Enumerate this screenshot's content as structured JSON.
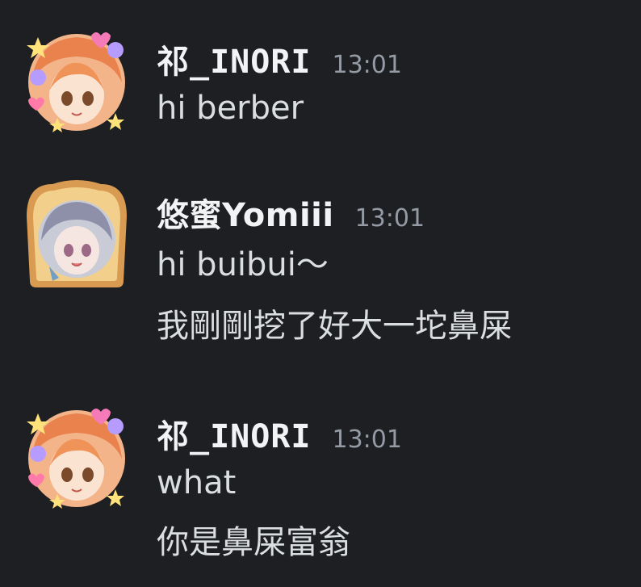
{
  "messages": [
    {
      "author": "祁_INORI",
      "timestamp": "13:01",
      "avatar_icon": "anime-girl-orange-hair-avatar-icon",
      "lines": [
        "hi berber"
      ]
    },
    {
      "author": "悠蜜Yomiii",
      "timestamp": "13:01",
      "avatar_icon": "anime-girl-toast-frame-avatar-icon",
      "lines": [
        "hi buibui～",
        "我剛剛挖了好大一坨鼻屎"
      ]
    },
    {
      "author": "祁_INORI",
      "timestamp": "13:01",
      "avatar_icon": "anime-girl-orange-hair-avatar-icon",
      "lines": [
        "what",
        "你是鼻屎富翁"
      ]
    }
  ],
  "colors": {
    "background": "#1e1f22",
    "username": "#f2f3f5",
    "timestamp": "#949ba4",
    "message_text": "#dbdee1"
  }
}
